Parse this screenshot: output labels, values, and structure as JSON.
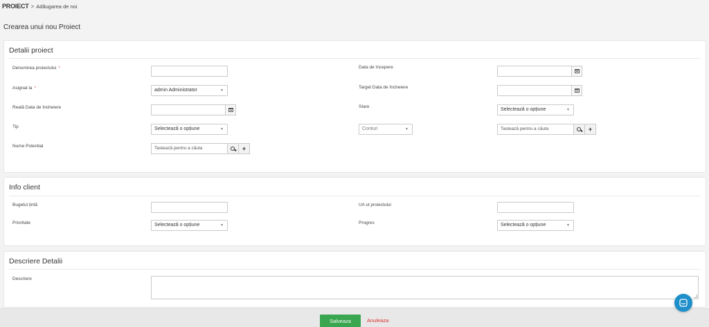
{
  "breadcrumb": {
    "root": "PROIECT",
    "separator": ">",
    "current": "Adăugarea de noi"
  },
  "page_title": "Crearea unui nou Proiect",
  "sections": {
    "details": {
      "title": "Detalii proiect",
      "name_label": "Denumirea proiectului",
      "name_value": "",
      "required_mark": "*",
      "assigned_label": "Asignat la",
      "assigned_value": "admin Administrator",
      "real_end_label": "Reală Data de încheiere",
      "type_label": "Tip",
      "type_value": "Selectează o opțiune",
      "potential_label": "Nume Potential",
      "start_date_label": "Data de începere",
      "target_end_label": "Target Data de încheiere",
      "status_label": "Stare",
      "status_value": "Selectează o opțiune",
      "account_type_value": "Conturi",
      "account_search_placeholder": "Tastează pentru a căuta",
      "potential_search_placeholder": "Tastează pentru a căuta"
    },
    "client": {
      "title": "Info client",
      "budget_label": "Bugetul țintă",
      "priority_label": "Prioritate",
      "priority_value": "Selectează o opțiune",
      "url_label": "Url-ul proiectului",
      "progress_label": "Progres",
      "progress_value": "Selectează o opțiune"
    },
    "description": {
      "title": "Descriere Detalii",
      "description_label": "Descriere"
    }
  },
  "footer": {
    "save_label": "Salveaza",
    "cancel_label": "Anuleaza"
  },
  "icons": {
    "calendar": "calendar-icon",
    "search": "search-icon",
    "add": "plus-icon",
    "caret": "caret-down-icon",
    "chat": "chat-icon"
  },
  "colors": {
    "save": "#3aa650",
    "cancel": "#e0302f",
    "chat": "#1e8fc9",
    "required": "#d9534f"
  }
}
